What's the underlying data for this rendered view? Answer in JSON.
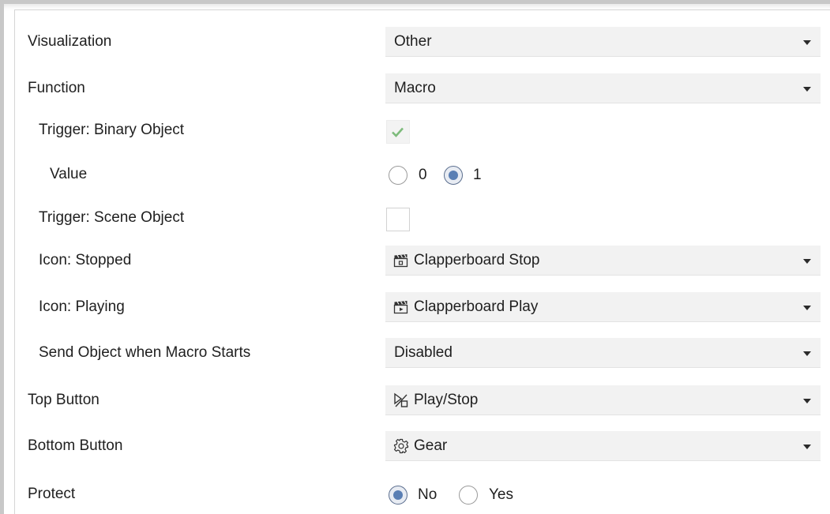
{
  "rows": {
    "visualization": {
      "label": "Visualization",
      "value": "Other"
    },
    "function": {
      "label": "Function",
      "value": "Macro"
    },
    "trigger_binary": {
      "label": "Trigger: Binary Object",
      "checked": true
    },
    "value": {
      "label": "Value",
      "options": [
        "0",
        "1"
      ],
      "selected": "1"
    },
    "trigger_scene": {
      "label": "Trigger: Scene Object",
      "checked": false
    },
    "icon_stopped": {
      "label": "Icon: Stopped",
      "value": "Clapperboard Stop",
      "icon": "clapperboard-stop-icon"
    },
    "icon_playing": {
      "label": "Icon: Playing",
      "value": "Clapperboard Play",
      "icon": "clapperboard-play-icon"
    },
    "send_object": {
      "label": "Send Object when Macro Starts",
      "value": "Disabled"
    },
    "top_button": {
      "label": "Top Button",
      "value": "Play/Stop",
      "icon": "play-stop-icon"
    },
    "bottom_button": {
      "label": "Bottom Button",
      "value": "Gear",
      "icon": "gear-icon"
    },
    "protect": {
      "label": "Protect",
      "options": [
        "No",
        "Yes"
      ],
      "selected": "No"
    }
  },
  "colors": {
    "combo_bg": "#f2f2f2",
    "check_green": "#7dbb7b",
    "radio_accent": "#5a7fb4"
  }
}
